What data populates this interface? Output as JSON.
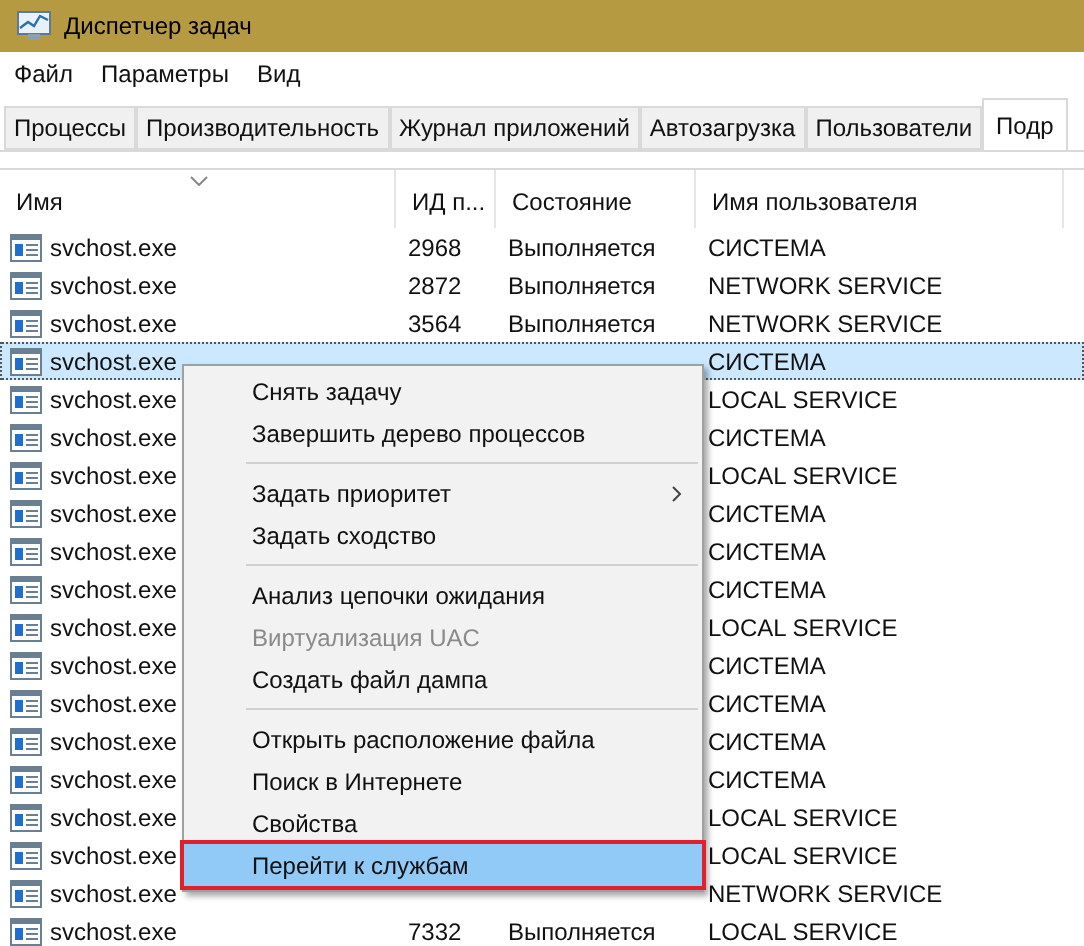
{
  "window": {
    "title": "Диспетчер задач"
  },
  "menu_bar": [
    "Файл",
    "Параметры",
    "Вид"
  ],
  "tabs": [
    {
      "label": "Процессы",
      "selected": false
    },
    {
      "label": "Производительность",
      "selected": false
    },
    {
      "label": "Журнал приложений",
      "selected": false
    },
    {
      "label": "Автозагрузка",
      "selected": false
    },
    {
      "label": "Пользователи",
      "selected": false
    },
    {
      "label": "Подр",
      "selected": true
    }
  ],
  "table": {
    "columns": [
      "Имя",
      "ИД п...",
      "Состояние",
      "Имя пользователя"
    ],
    "rows": [
      {
        "name": "svchost.exe",
        "pid": "2968",
        "status": "Выполняется",
        "user": "СИСТЕМА",
        "selected": false
      },
      {
        "name": "svchost.exe",
        "pid": "2872",
        "status": "Выполняется",
        "user": "NETWORK SERVICE",
        "selected": false
      },
      {
        "name": "svchost.exe",
        "pid": "3564",
        "status": "Выполняется",
        "user": "NETWORK SERVICE",
        "selected": false
      },
      {
        "name": "svchost.exe",
        "user": "СИСТЕМА",
        "selected": true
      },
      {
        "name": "svchost.exe",
        "user": "LOCAL SERVICE",
        "selected": false
      },
      {
        "name": "svchost.exe",
        "user": "СИСТЕМА",
        "selected": false
      },
      {
        "name": "svchost.exe",
        "user": "LOCAL SERVICE",
        "selected": false
      },
      {
        "name": "svchost.exe",
        "user": "СИСТЕМА",
        "selected": false
      },
      {
        "name": "svchost.exe",
        "user": "СИСТЕМА",
        "selected": false
      },
      {
        "name": "svchost.exe",
        "user": "СИСТЕМА",
        "selected": false
      },
      {
        "name": "svchost.exe",
        "user": "LOCAL SERVICE",
        "selected": false
      },
      {
        "name": "svchost.exe",
        "user": "СИСТЕМА",
        "selected": false
      },
      {
        "name": "svchost.exe",
        "user": "СИСТЕМА",
        "selected": false
      },
      {
        "name": "svchost.exe",
        "user": "СИСТЕМА",
        "selected": false
      },
      {
        "name": "svchost.exe",
        "user": "СИСТЕМА",
        "selected": false
      },
      {
        "name": "svchost.exe",
        "user": "LOCAL SERVICE",
        "selected": false
      },
      {
        "name": "svchost.exe",
        "user": "LOCAL SERVICE",
        "selected": false
      },
      {
        "name": "svchost.exe",
        "user": "NETWORK SERVICE",
        "selected": false
      },
      {
        "name": "svchost.exe",
        "pid": "7332",
        "status": "Выполняется",
        "user": "LOCAL SERVICE",
        "selected": false
      }
    ]
  },
  "context_menu": {
    "groups": [
      [
        {
          "label": "Снять задачу",
          "disabled": false,
          "submenu": false,
          "selected": false
        },
        {
          "label": "Завершить дерево процессов",
          "disabled": false,
          "submenu": false,
          "selected": false
        }
      ],
      [
        {
          "label": "Задать приоритет",
          "disabled": false,
          "submenu": true,
          "selected": false
        },
        {
          "label": "Задать сходство",
          "disabled": false,
          "submenu": false,
          "selected": false
        }
      ],
      [
        {
          "label": "Анализ цепочки ожидания",
          "disabled": false,
          "submenu": false,
          "selected": false
        },
        {
          "label": "Виртуализация UAC",
          "disabled": true,
          "submenu": false,
          "selected": false
        },
        {
          "label": "Создать файл дампа",
          "disabled": false,
          "submenu": false,
          "selected": false
        }
      ],
      [
        {
          "label": "Открыть расположение файла",
          "disabled": false,
          "submenu": false,
          "selected": false
        },
        {
          "label": "Поиск в Интернете",
          "disabled": false,
          "submenu": false,
          "selected": false
        },
        {
          "label": "Свойства",
          "disabled": false,
          "submenu": false,
          "selected": false
        },
        {
          "label": "Перейти к службам",
          "disabled": false,
          "submenu": false,
          "selected": true
        }
      ]
    ]
  }
}
